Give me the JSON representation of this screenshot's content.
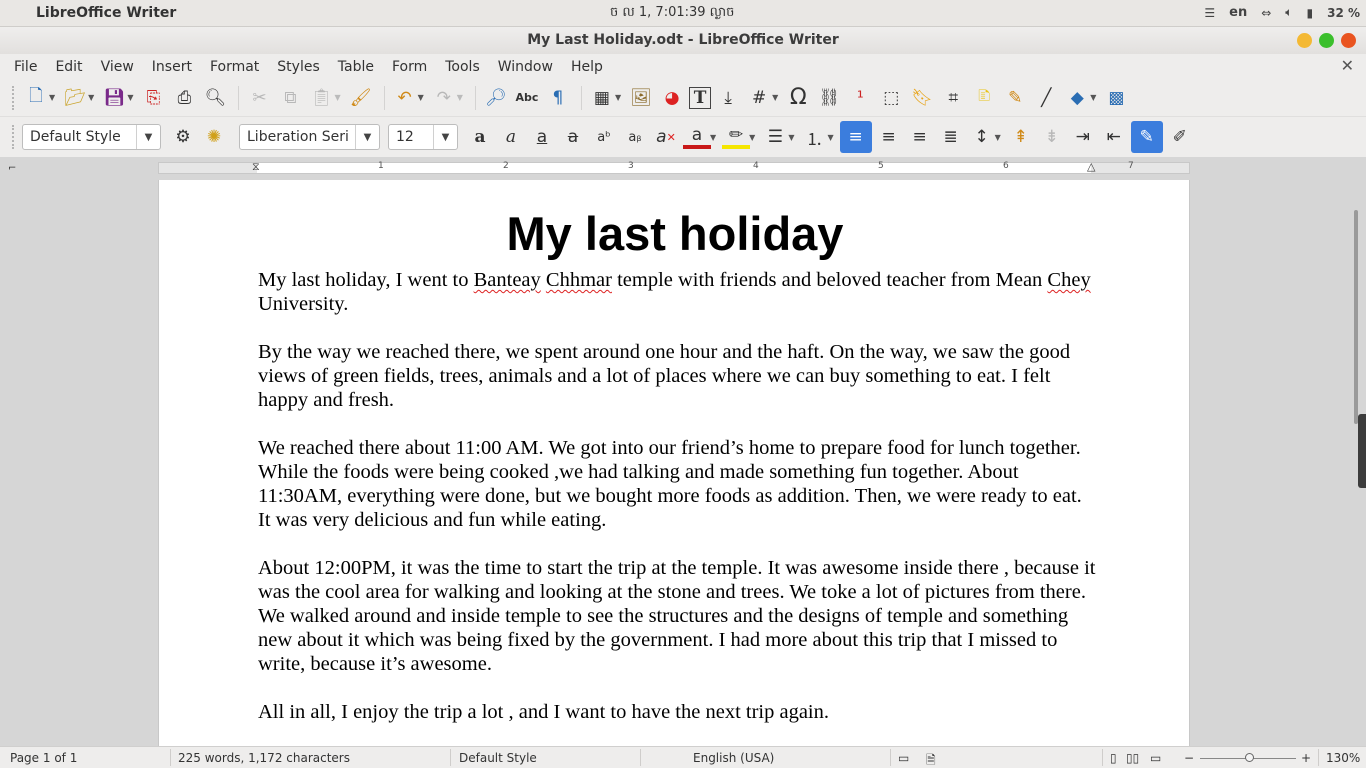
{
  "system_panel": {
    "app_name": "LibreOffice Writer",
    "clock": "ច ល  1,  7:01:39 ល្ងាច",
    "keyboard": "en",
    "battery": "32 %"
  },
  "window": {
    "title": "My Last Holiday.odt - LibreOffice Writer"
  },
  "menubar": {
    "items": [
      "File",
      "Edit",
      "View",
      "Insert",
      "Format",
      "Styles",
      "Table",
      "Form",
      "Tools",
      "Window",
      "Help"
    ]
  },
  "format_toolbar": {
    "paragraph_style": "Default Style",
    "font_name": "Liberation Seri",
    "font_size": "12"
  },
  "ruler": {
    "labels": [
      "1",
      "2",
      "3",
      "4",
      "5",
      "6",
      "7"
    ]
  },
  "document": {
    "title": "My last holiday",
    "paragraphs": [
      "My last holiday, I went to Banteay Chhmar temple with friends and beloved teacher from Mean Chey University.",
      "By the way we reached there, we spent  around one hour and the haft. On the way, we saw the good views of green fields, trees, animals and a lot of places where we can buy something to eat. I felt happy and fresh.",
      "We reached there about 11:00 AM. We got into our friend’s home to prepare food for lunch together. While the foods were being cooked ,we had talking and made something fun together. About 11:30AM, everything were done, but we bought more foods as addition. Then, we were ready to eat. It was very delicious and fun while eating.",
      "About 12:00PM, it was the time to start the trip at the temple. It was awesome inside there , because it was the cool area for walking and looking at the stone and trees. We toke a lot of pictures from there. We walked around and inside temple to see the structures and the designs of temple and something new about it which was being fixed by the government. I had more about this trip that I missed to write, because it’s awesome.",
      "All in all, I enjoy the trip a lot , and I want to have the next trip again."
    ]
  },
  "statusbar": {
    "page": "Page 1 of 1",
    "word_count": "225 words, 1,172 characters",
    "page_style": "Default Style",
    "language": "English (USA)",
    "zoom": "130%"
  },
  "colors": {
    "accent": "#3b7ddd",
    "window_close": "#e95420",
    "spell_underline": "#dd2222"
  }
}
